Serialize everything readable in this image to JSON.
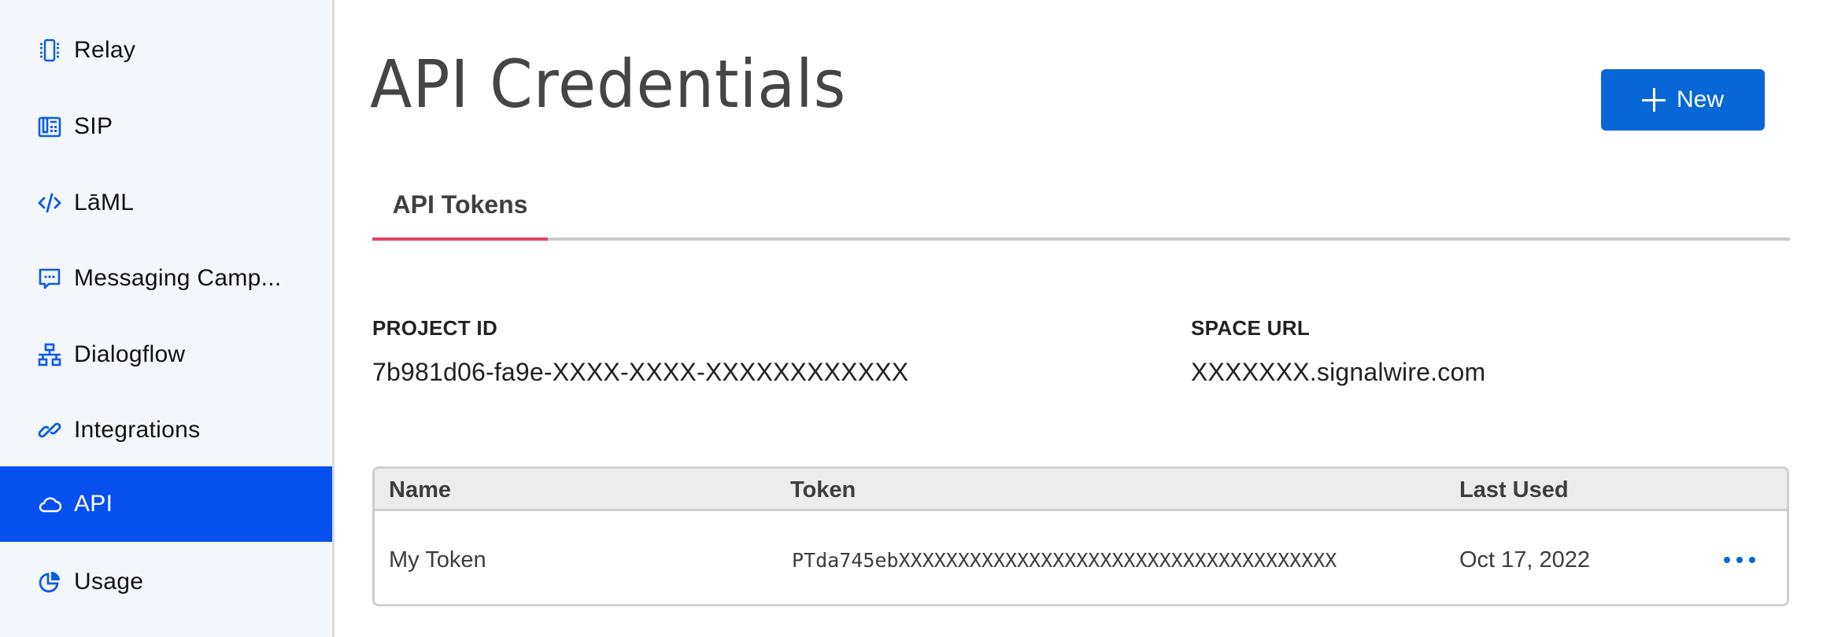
{
  "sidebar": {
    "accent_color": "#0750f0",
    "icon_color": "#0a5be8",
    "items": [
      {
        "label": "Relay",
        "icon": "chip-icon",
        "active": false
      },
      {
        "label": "SIP",
        "icon": "desk-phone-icon",
        "active": false
      },
      {
        "label": "LāML",
        "icon": "code-icon",
        "active": false
      },
      {
        "label": "Messaging Camp...",
        "icon": "chat-bubble-icon",
        "active": false
      },
      {
        "label": "Dialogflow",
        "icon": "network-icon",
        "active": false
      },
      {
        "label": "Integrations",
        "icon": "link-icon",
        "active": false
      },
      {
        "label": "API",
        "icon": "cloud-icon",
        "active": true
      },
      {
        "label": "Usage",
        "icon": "pie-chart-icon",
        "active": false
      }
    ]
  },
  "header": {
    "title": "API Credentials",
    "new_button_label": "New",
    "new_button_icon": "plus-icon",
    "new_button_color": "#0767d7"
  },
  "tabs": [
    {
      "label": "API Tokens",
      "active": true,
      "indicator_color": "#ea4165"
    }
  ],
  "project": {
    "project_id_label": "PROJECT ID",
    "project_id_value": "7b981d06-fa9e-XXXX-XXXX-XXXXXXXXXXXX",
    "space_url_label": "SPACE URL",
    "space_url_value": "XXXXXXX.signalwire.com"
  },
  "tokens_table": {
    "columns": [
      "Name",
      "Token",
      "Last Used"
    ],
    "rows": [
      {
        "name": "My Token",
        "token": "PTda745ebXXXXXXXXXXXXXXXXXXXXXXXXXXXXXXXXXXXXX",
        "last_used": "Oct 17, 2022",
        "actions_icon": "more-horizontal-icon"
      }
    ]
  }
}
